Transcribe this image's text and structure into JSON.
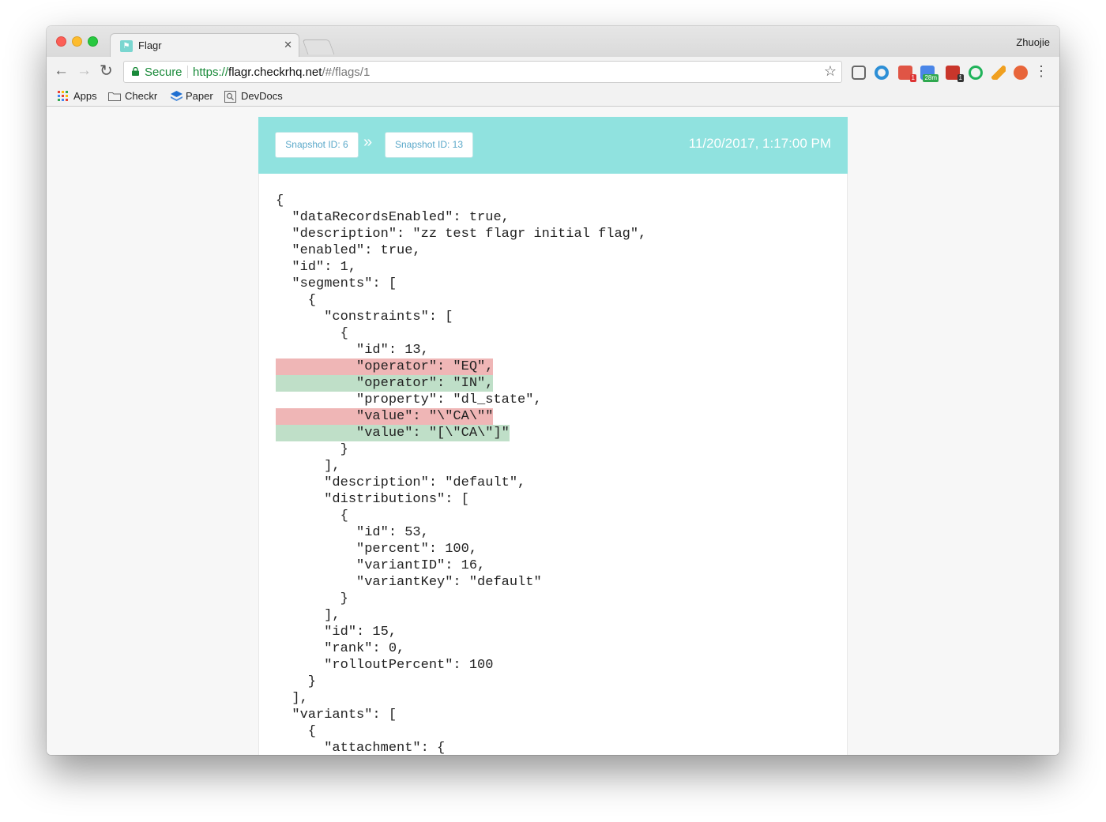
{
  "browser": {
    "tab_title": "Flagr",
    "profile_name": "Zhuojie",
    "secure_label": "Secure",
    "url": {
      "scheme": "https://",
      "host": "flagr.checkrhq.net",
      "path": "/#/flags/1"
    },
    "bookmarks": [
      "Apps",
      "Checkr",
      "Paper",
      "DevDocs"
    ],
    "extension_badges": [
      "1",
      "28m",
      "1"
    ]
  },
  "snapshot": {
    "from_label": "Snapshot ID: 6",
    "to_label": "Snapshot ID: 13",
    "timestamp": "11/20/2017, 1:17:00 PM"
  },
  "diff_lines": [
    {
      "text": "{",
      "status": "same"
    },
    {
      "text": "  \"dataRecordsEnabled\": true,",
      "status": "same"
    },
    {
      "text": "  \"description\": \"zz test flagr initial flag\",",
      "status": "same"
    },
    {
      "text": "  \"enabled\": true,",
      "status": "same"
    },
    {
      "text": "  \"id\": 1,",
      "status": "same"
    },
    {
      "text": "  \"segments\": [",
      "status": "same"
    },
    {
      "text": "    {",
      "status": "same"
    },
    {
      "text": "      \"constraints\": [",
      "status": "same"
    },
    {
      "text": "        {",
      "status": "same"
    },
    {
      "text": "          \"id\": 13,",
      "status": "same"
    },
    {
      "text": "          \"operator\": \"EQ\",",
      "status": "removed"
    },
    {
      "text": "          \"operator\": \"IN\",",
      "status": "added"
    },
    {
      "text": "          \"property\": \"dl_state\",",
      "status": "same"
    },
    {
      "text": "          \"value\": \"\\\"CA\\\"\"",
      "status": "removed"
    },
    {
      "text": "          \"value\": \"[\\\"CA\\\"]\"",
      "status": "added"
    },
    {
      "text": "        }",
      "status": "same"
    },
    {
      "text": "      ],",
      "status": "same"
    },
    {
      "text": "      \"description\": \"default\",",
      "status": "same"
    },
    {
      "text": "      \"distributions\": [",
      "status": "same"
    },
    {
      "text": "        {",
      "status": "same"
    },
    {
      "text": "          \"id\": 53,",
      "status": "same"
    },
    {
      "text": "          \"percent\": 100,",
      "status": "same"
    },
    {
      "text": "          \"variantID\": 16,",
      "status": "same"
    },
    {
      "text": "          \"variantKey\": \"default\"",
      "status": "same"
    },
    {
      "text": "        }",
      "status": "same"
    },
    {
      "text": "      ],",
      "status": "same"
    },
    {
      "text": "      \"id\": 15,",
      "status": "same"
    },
    {
      "text": "      \"rank\": 0,",
      "status": "same"
    },
    {
      "text": "      \"rolloutPercent\": 100",
      "status": "same"
    },
    {
      "text": "    }",
      "status": "same"
    },
    {
      "text": "  ],",
      "status": "same"
    },
    {
      "text": "  \"variants\": [",
      "status": "same"
    },
    {
      "text": "    {",
      "status": "same"
    },
    {
      "text": "      \"attachment\": {",
      "status": "same"
    }
  ],
  "colors": {
    "header_bg": "#90e2df",
    "removed_bg": "#efb6b6",
    "added_bg": "#bfdfc8",
    "secure_green": "#1a8a3a"
  }
}
